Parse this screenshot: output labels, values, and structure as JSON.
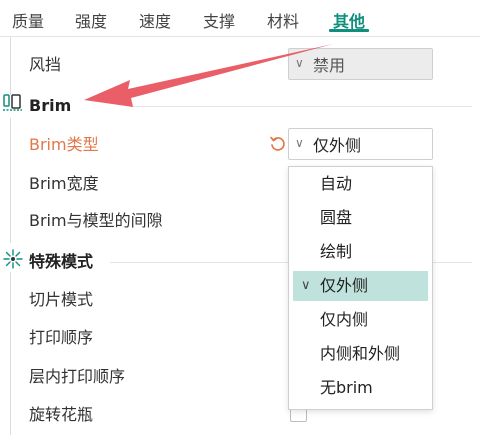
{
  "tabs": [
    {
      "label": "质量",
      "active": false
    },
    {
      "label": "强度",
      "active": false
    },
    {
      "label": "速度",
      "active": false
    },
    {
      "label": "支撑",
      "active": false
    },
    {
      "label": "材料",
      "active": false
    },
    {
      "label": "其他",
      "active": true
    }
  ],
  "settings": {
    "windshield": {
      "label": "风挡",
      "value": "禁用",
      "disabled": true
    },
    "brim_section": {
      "title": "Brim",
      "icon": "brim-icon"
    },
    "brim_type": {
      "label": "Brim类型",
      "value": "仅外侧",
      "modified": true
    },
    "brim_width": {
      "label": "Brim宽度"
    },
    "brim_gap": {
      "label": "Brim与模型的间隙"
    },
    "special_section": {
      "title": "特殊模式",
      "icon": "special-mode-icon"
    },
    "slice_mode": {
      "label": "切片模式"
    },
    "print_sequence": {
      "label": "打印顺序"
    },
    "intra_layer_order": {
      "label": "层内打印顺序"
    },
    "spiral_vase": {
      "label": "旋转花瓶",
      "checked": false
    }
  },
  "brim_type_dropdown": {
    "options": [
      "自动",
      "圆盘",
      "绘制",
      "仅外侧",
      "仅内侧",
      "内侧和外侧",
      "无brim"
    ],
    "selected": "仅外侧"
  },
  "colors": {
    "accent": "#0f8f7e",
    "modified_label": "#e2784a",
    "selected_option_bg": "#bfe3dc",
    "annotation_arrow": "#e8505b"
  }
}
